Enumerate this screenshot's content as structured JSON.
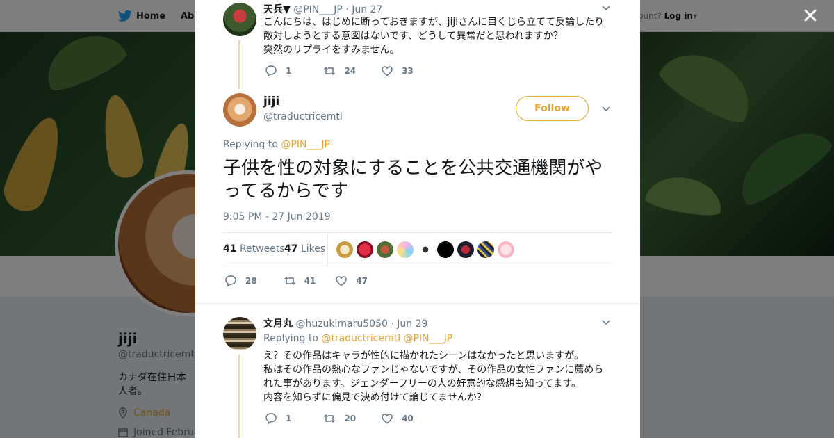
{
  "nav": {
    "home": "Home",
    "about": "Abo",
    "account": "ccount?",
    "login": "Log in"
  },
  "profile": {
    "name": "jiji",
    "handle": "@traductricemtl",
    "bio": "カナダ在住日本人者。",
    "location": "Canada",
    "joined": "Joined Februa"
  },
  "modal": {
    "prev_tweet": {
      "name": "天兵▼",
      "handle": "@PIN___JP",
      "date": "· Jun 27",
      "lines": [
        "こんにちは、はじめに断っておきますが、jijiさんに目くじら立てて反論したり",
        "敵対しようとする意図はないです、どうして異常だと思われますか？",
        "突然のリプライをすみません。"
      ],
      "replies": "1",
      "retweets": "24",
      "likes": "33"
    },
    "main_tweet": {
      "name": "jiji",
      "handle": "@traductricemtl",
      "follow": "Follow",
      "replying_to_label": "Replying to",
      "replying_to": "@PIN___JP",
      "text": "子供を性の対象にすることを公共交通機関がやってるからです",
      "timestamp": "9:05 PM - 27 Jun 2019",
      "retweets_count": "41",
      "retweets_label": "Retweets",
      "likes_count": "47",
      "likes_label": "Likes",
      "replies": "28",
      "retweets": "41",
      "likes": "47"
    },
    "reply_tweet": {
      "name": "文月丸",
      "handle": "@huzukimaru5050",
      "date": "· Jun 29",
      "replying_to_label": "Replying to",
      "replying_to_1": "@traductricemtl",
      "replying_to_2": "@PIN___JP",
      "lines": [
        "え？その作品はキャラが性的に描かれたシーンはなかったと思いますが。",
        "私はその作品の熱心なファンじゃないですが、その作品の女性ファンに薦めら",
        "れた事があります。ジェンダーフリーの人の好意的な感想も知ってます。",
        "内容を知らずに偏見で決め付けて論じてませんか？"
      ],
      "replies": "1",
      "retweets": "20",
      "likes": "40"
    }
  },
  "colors": {
    "accent": "#e8a32e",
    "text": "#14171a",
    "muted": "#657786",
    "twitter_blue": "#1da1f2"
  }
}
